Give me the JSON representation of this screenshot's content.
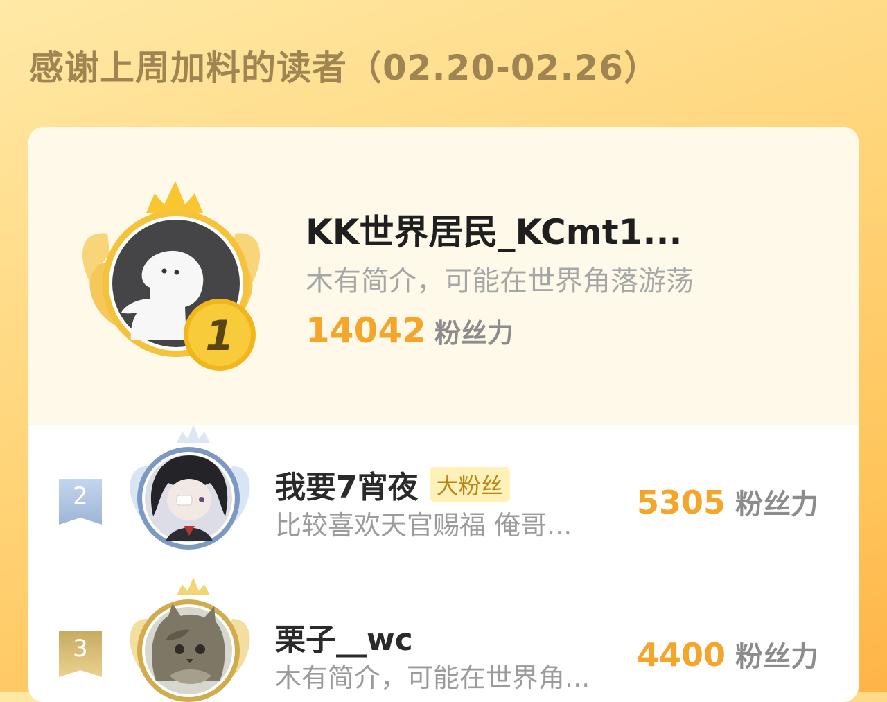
{
  "header": {
    "title": "感谢上周加料的读者（02.20-02.26）"
  },
  "first_place": {
    "rank": "1",
    "name": "KK世界居民_KCmt1...",
    "bio": "木有简介，可能在世界角落游荡",
    "score": "14042",
    "score_unit": "粉丝力"
  },
  "ranking": [
    {
      "rank": "2",
      "name": "我要7宵夜",
      "badge": "大粉丝",
      "bio": "比较喜欢天官赐福 俺哥...",
      "score": "5305",
      "score_unit": "粉丝力"
    },
    {
      "rank": "3",
      "name": "栗子__wc",
      "badge": "",
      "bio": "木有简介，可能在世界角...",
      "score": "4400",
      "score_unit": "粉丝力"
    }
  ],
  "colors": {
    "accent": "#f5a52a",
    "gold": "#f3c02f",
    "silver": "#a9c2e2",
    "bronze": "#d9b255"
  }
}
